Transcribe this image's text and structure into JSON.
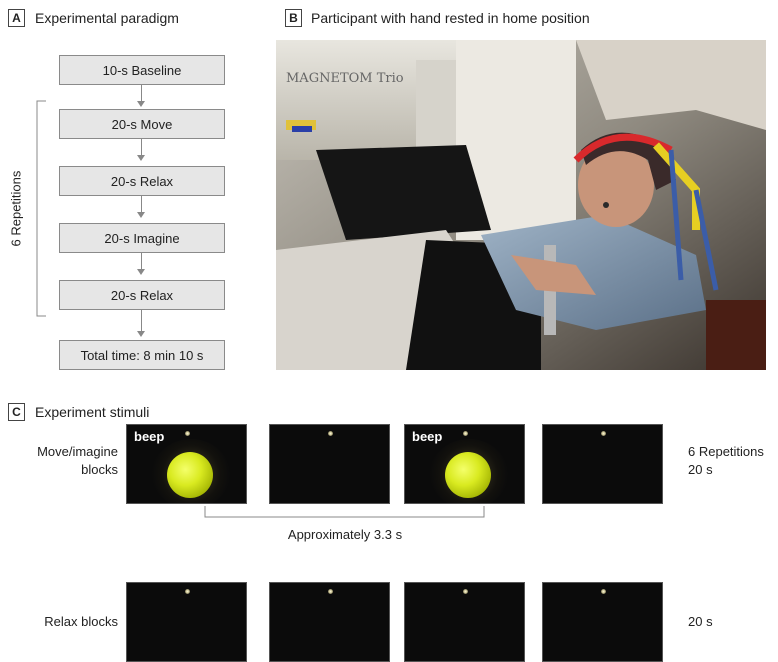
{
  "panel_a": {
    "letter": "A",
    "title": "Experimental paradigm",
    "steps": [
      "10-s Baseline",
      "20-s Move",
      "20-s Relax",
      "20-s Imagine",
      "20-s Relax",
      "Total time: 8 min 10 s"
    ],
    "bracket_label": "6 Repetitions"
  },
  "panel_b": {
    "letter": "B",
    "title": "Participant with hand rested in home position",
    "scanner_text": "MAGNETOM Trio"
  },
  "panel_c": {
    "letter": "C",
    "title": "Experiment stimuli",
    "row1_label_line1": "Move/imagine",
    "row1_label_line2": "blocks",
    "row1_right_line1": "6 Repetitions",
    "row1_right_line2": "20 s",
    "beep_label": "beep",
    "interval_label": "Approximately 3.3 s",
    "row2_label": "Relax blocks",
    "row2_right": "20 s"
  },
  "colors": {
    "box_fill": "#e6e6e6",
    "box_border": "#8a8a8a",
    "ball": "#d9ea20",
    "frame_bg": "#0b0b0b"
  }
}
